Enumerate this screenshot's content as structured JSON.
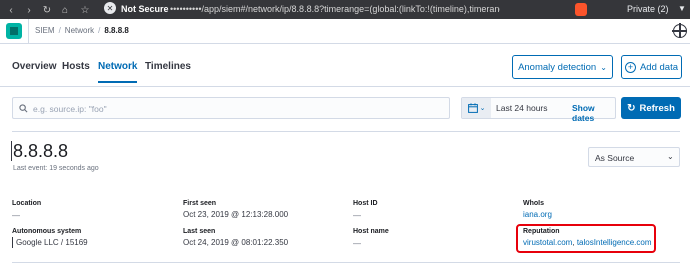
{
  "browser": {
    "security_label": "Not Secure",
    "url": "••••••••••/app/siem#/network/ip/8.8.8.8?timerange=(global:(linkTo:!(timeline),timerange:(from",
    "profile_label": "Private (2)"
  },
  "header": {
    "breadcrumbs": [
      "SIEM",
      "Network",
      "8.8.8.8"
    ]
  },
  "tabs": [
    {
      "label": "Overview"
    },
    {
      "label": "Hosts"
    },
    {
      "label": "Network"
    },
    {
      "label": "Timelines"
    }
  ],
  "toolbar": {
    "anomaly_label": "Anomaly detection",
    "add_data_label": "Add data"
  },
  "search": {
    "placeholder": "e.g. source.ip: \"foo\"",
    "value": ""
  },
  "datepicker": {
    "range": "Last 24 hours",
    "show_dates": "Show dates"
  },
  "refresh_label": "Refresh",
  "ip": {
    "title": "8.8.8.8",
    "last_event": "Last event: 19 seconds ago",
    "source_select": "As Source"
  },
  "details": {
    "location": {
      "label": "Location",
      "value": "—"
    },
    "first_seen": {
      "label": "First seen",
      "value": "Oct 23, 2019 @ 12:13:28.000"
    },
    "host_id": {
      "label": "Host ID",
      "value": "—"
    },
    "whois": {
      "label": "WhoIs",
      "value": "iana.org"
    },
    "asn": {
      "label": "Autonomous system",
      "value": "Google LLC / 15169"
    },
    "last_seen": {
      "label": "Last seen",
      "value": "Oct 24, 2019 @ 08:01:22.350"
    },
    "host_name": {
      "label": "Host name",
      "value": "—"
    },
    "reputation": {
      "label": "Reputation",
      "link1": "virustotal.com",
      "separator": ", ",
      "link2": "talosIntelligence.com"
    }
  },
  "colors": {
    "accent": "#006bb4",
    "highlight_box": "#e7000b",
    "logo": "#00b3a4"
  }
}
